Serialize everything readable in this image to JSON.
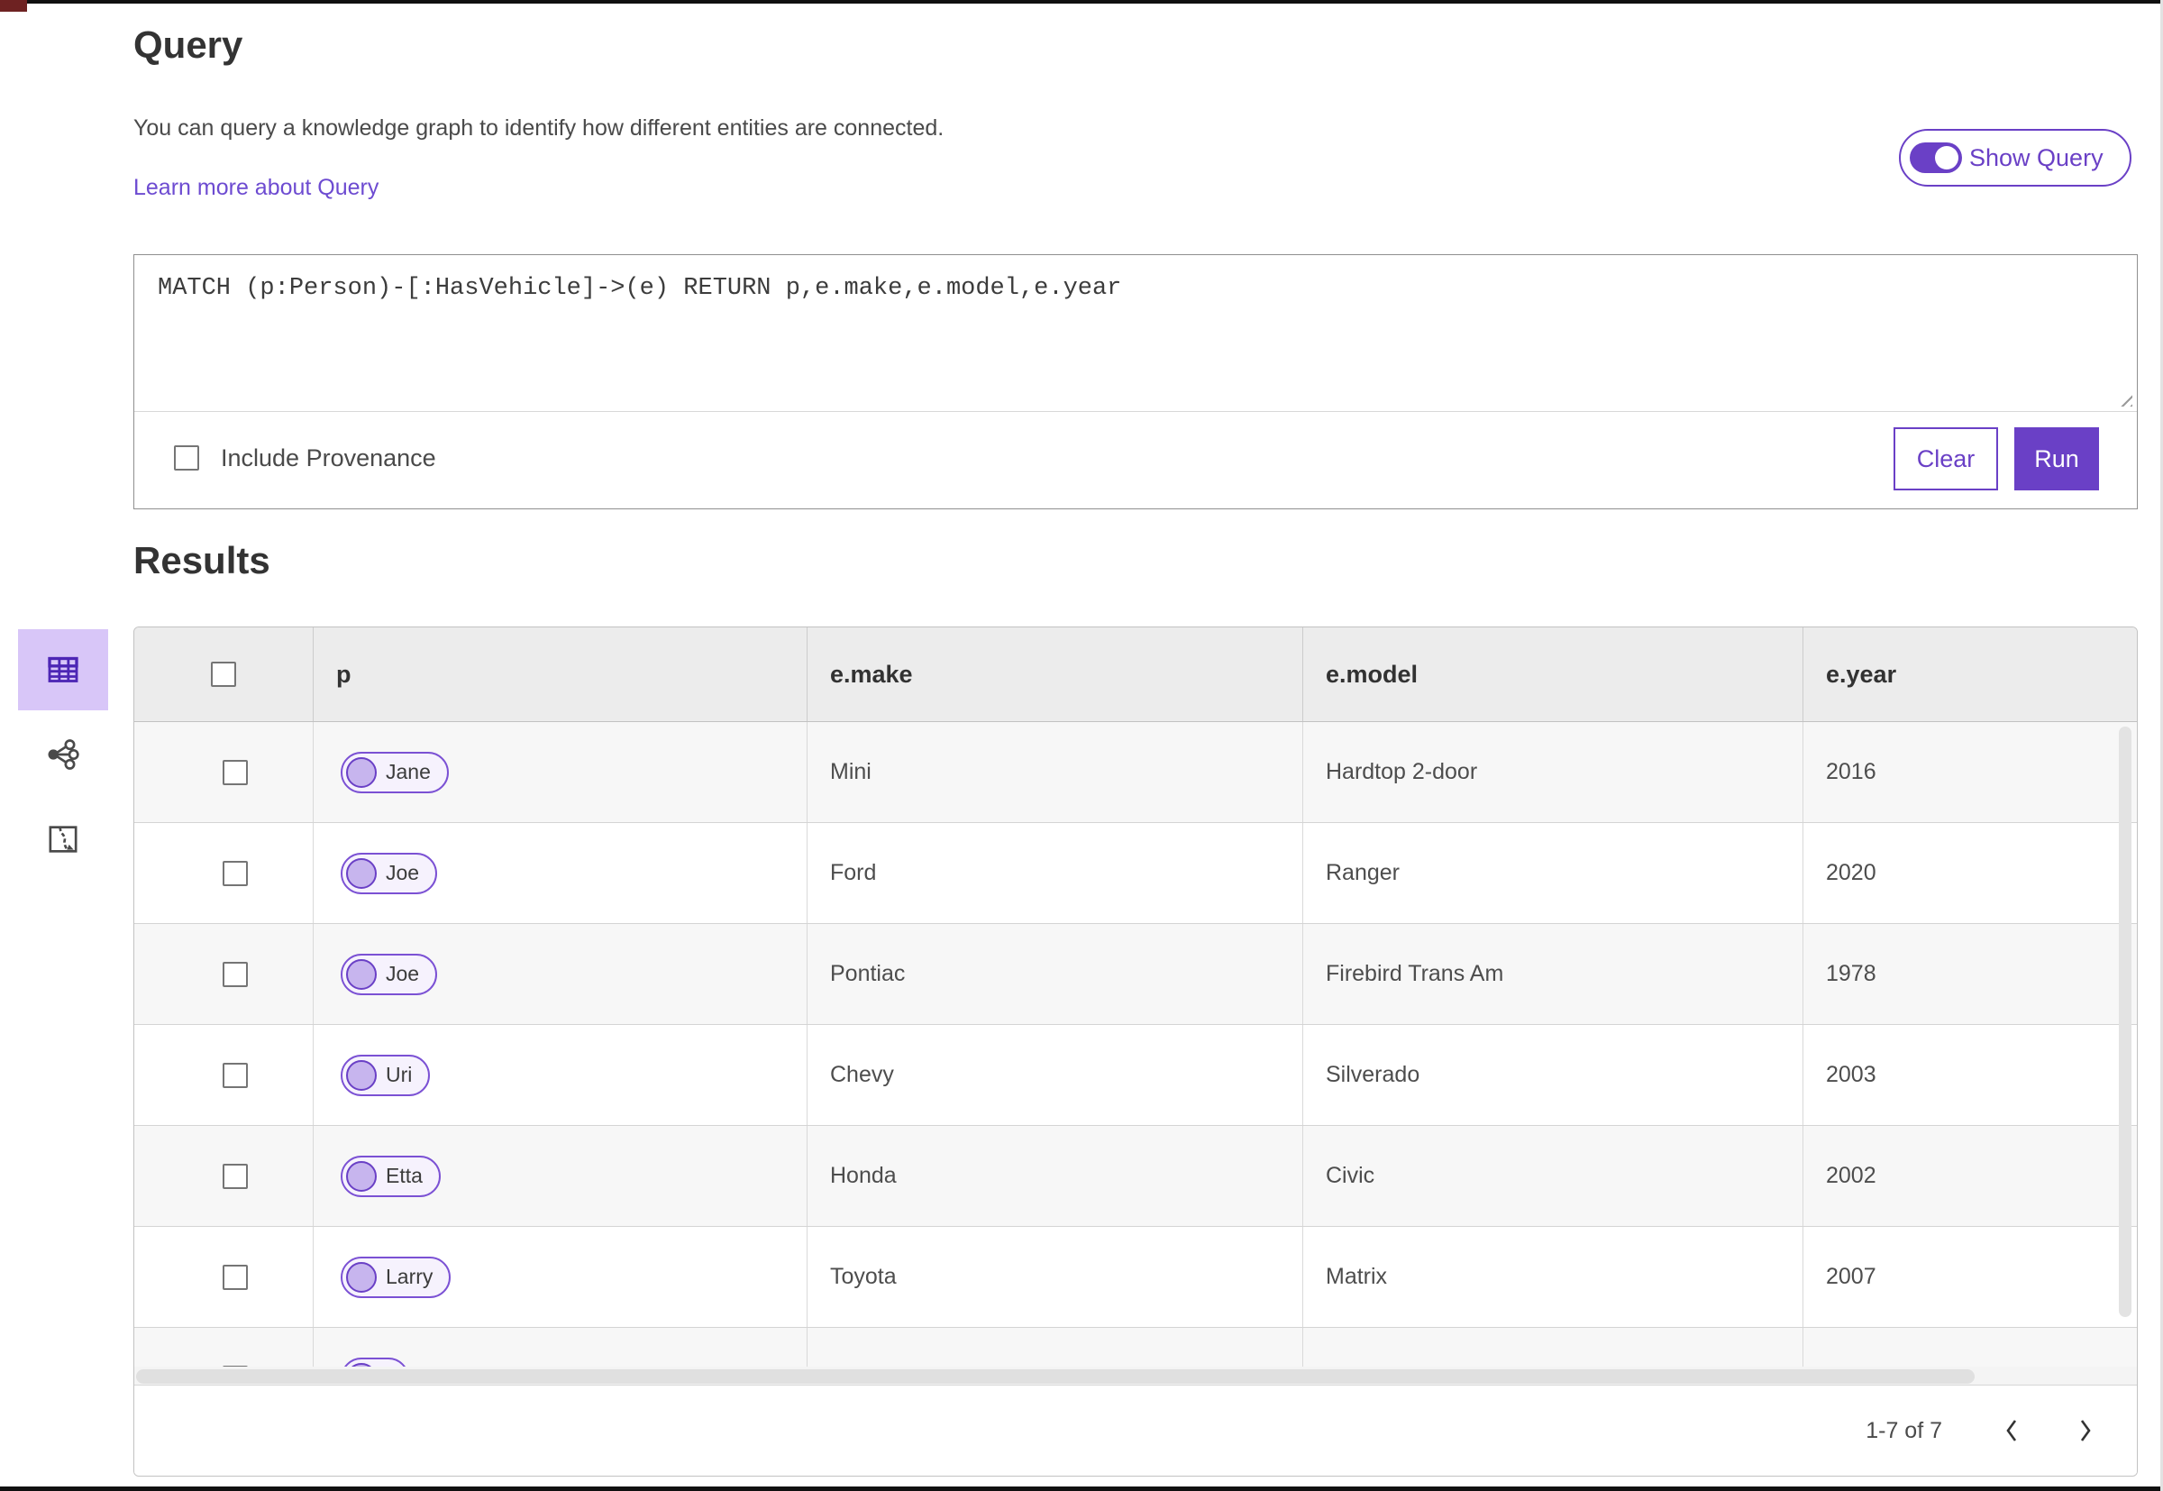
{
  "page": {
    "title": "Query",
    "description": "You can query a knowledge graph to identify how different entities are connected.",
    "learn_more_link": "Learn more about Query",
    "show_query_toggle": {
      "label": "Show Query",
      "state": "on"
    }
  },
  "query_editor": {
    "query_text": "MATCH (p:Person)-[:HasVehicle]->(e) RETURN p,e.make,e.model,e.year",
    "include_provenance": {
      "label": "Include Provenance",
      "checked": false
    },
    "clear_button": "Clear",
    "run_button": "Run"
  },
  "results": {
    "title": "Results",
    "view_switcher": [
      {
        "icon": "table-view-icon",
        "selected": true
      },
      {
        "icon": "link-chart-view-icon",
        "selected": false
      },
      {
        "icon": "map-view-icon",
        "selected": false
      }
    ],
    "table": {
      "columns": [
        "p",
        "e.make",
        "e.model",
        "e.year"
      ],
      "rows": [
        {
          "p": "Jane",
          "make": "Mini",
          "model": "Hardtop 2-door",
          "year": "2016"
        },
        {
          "p": "Joe",
          "make": "Ford",
          "model": "Ranger",
          "year": "2020"
        },
        {
          "p": "Joe",
          "make": "Pontiac",
          "model": "Firebird Trans Am",
          "year": "1978"
        },
        {
          "p": "Uri",
          "make": "Chevy",
          "model": "Silverado",
          "year": "2003"
        },
        {
          "p": "Etta",
          "make": "Honda",
          "model": "Civic",
          "year": "2002"
        },
        {
          "p": "Larry",
          "make": "Toyota",
          "model": "Matrix",
          "year": "2007"
        },
        {
          "p": "",
          "make": "",
          "model": "",
          "year": "",
          "partial": true
        }
      ]
    },
    "pagination": {
      "range_label": "1-7 of 7"
    }
  },
  "colors": {
    "accent": "#6a40c6",
    "accent-light": "#d8c6f8",
    "link": "#6d4bd1",
    "chip-border": "#7b51d4",
    "chip-bg": "#f6f2fd",
    "chip-circle": "#c7b5ee",
    "header-bg": "#ececec",
    "row-alt": "#f7f7f7"
  }
}
